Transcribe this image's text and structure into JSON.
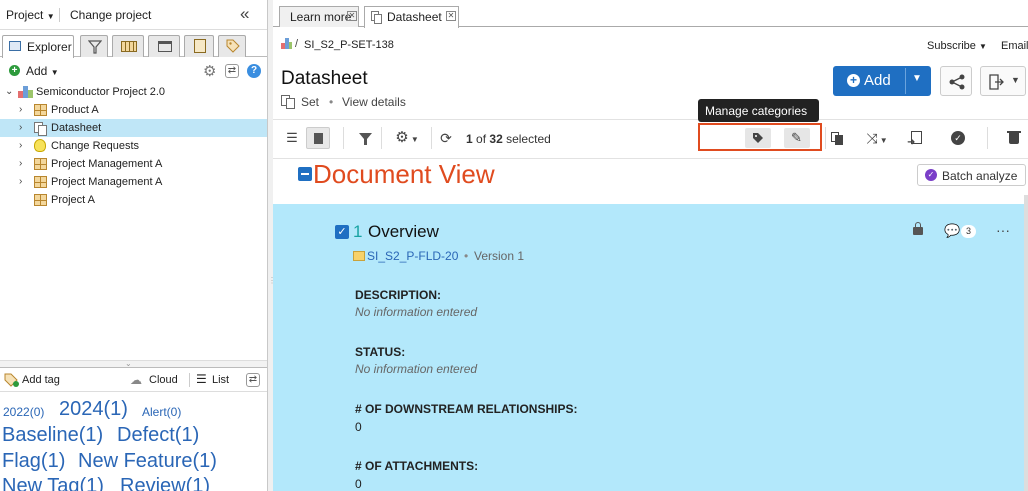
{
  "left": {
    "project_label": "Project",
    "change_project": "Change project",
    "explorer_tab": "Explorer",
    "add_label": "Add",
    "tree": [
      {
        "label": "Semiconductor Project 2.0",
        "icon": "project-icon"
      },
      {
        "label": "Product A",
        "icon": "grid-icon"
      },
      {
        "label": "Datasheet",
        "icon": "set-icon"
      },
      {
        "label": "Change Requests",
        "icon": "bulb-icon"
      },
      {
        "label": "Project Management A",
        "icon": "grid-icon"
      },
      {
        "label": "Project Management A",
        "icon": "grid-icon"
      },
      {
        "label": "Project A",
        "icon": "grid-icon"
      }
    ],
    "tags_toolbar": {
      "add_tag": "Add tag",
      "cloud": "Cloud",
      "list": "List"
    },
    "tags": [
      {
        "label": "2022(0)"
      },
      {
        "label": "2024(1)"
      },
      {
        "label": "Alert(0)"
      },
      {
        "label": "Baseline(1)"
      },
      {
        "label": "Defect(1)"
      },
      {
        "label": "Flag(1)"
      },
      {
        "label": "New Feature(1)"
      },
      {
        "label": "New Tag(1)"
      },
      {
        "label": "Review(1)"
      }
    ]
  },
  "tabs": [
    {
      "label": "Learn more"
    },
    {
      "label": "Datasheet"
    }
  ],
  "header": {
    "breadcrumb": "SI_S2_P-SET-138",
    "subscribe": "Subscribe",
    "email": "Email",
    "title": "Datasheet",
    "type": "Set",
    "view_details": "View details",
    "add_button": "Add"
  },
  "toolbar": {
    "count": "1",
    "of": "of",
    "total": "32",
    "selected": "selected",
    "tooltip": "Manage categories"
  },
  "annotation": {
    "text": "Document View"
  },
  "batch_analyze": "Batch analyze",
  "item": {
    "number": "1",
    "title": "Overview",
    "comment_count": "3",
    "folder": "SI_S2_P-FLD-20",
    "version": "Version 1",
    "fields": [
      {
        "label": "DESCRIPTION:",
        "value": "No information entered"
      },
      {
        "label": "STATUS:",
        "value": "No information entered"
      },
      {
        "label": "# OF DOWNSTREAM RELATIONSHIPS:",
        "value": "0"
      },
      {
        "label": "# OF ATTACHMENTS:",
        "value": "0"
      }
    ]
  },
  "colors": {
    "accent": "#1f6fc2",
    "selection": "#bfe6f7",
    "content_bg": "#b3e8fb",
    "annotation": "#e04b1f"
  }
}
